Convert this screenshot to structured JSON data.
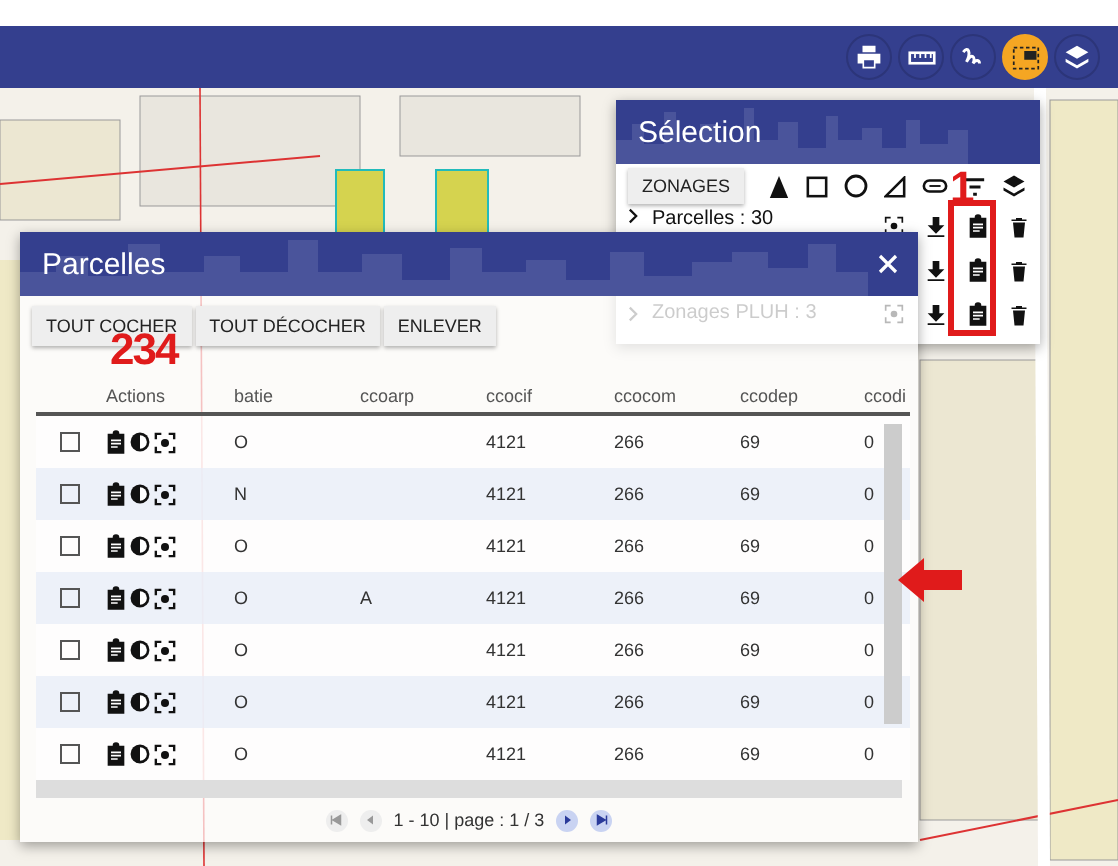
{
  "toolbar": {
    "buttons": [
      {
        "kind": "print",
        "selected": false
      },
      {
        "kind": "ruler",
        "selected": false
      },
      {
        "kind": "draw",
        "selected": false
      },
      {
        "kind": "select",
        "selected": true
      },
      {
        "kind": "layers",
        "selected": false
      }
    ]
  },
  "selection": {
    "title": "Sélection",
    "zonages_button": "ZONAGES",
    "tools": [
      {
        "kind": "pointer"
      },
      {
        "kind": "square"
      },
      {
        "kind": "circle"
      },
      {
        "kind": "triangle"
      },
      {
        "kind": "link"
      },
      {
        "kind": "filter"
      },
      {
        "kind": "layers"
      }
    ],
    "rows": [
      {
        "label": "Parcelles : 30",
        "dimmed": false
      },
      {},
      {
        "label": "Zonages PLUH : 3",
        "dimmed": true
      }
    ]
  },
  "annotations": [
    {
      "text": "1"
    },
    {
      "text": "234"
    }
  ],
  "parcelles": {
    "title": "Parcelles",
    "buttons": [
      "TOUT COCHER",
      "TOUT DÉCOCHER",
      "ENLEVER"
    ],
    "columns": [
      "Actions",
      "batie",
      "ccoarp",
      "ccocif",
      "ccocom",
      "ccodep",
      "ccodi"
    ],
    "rows": [
      {
        "checked": false,
        "cells": [
          null,
          "O",
          null,
          "4121",
          "266",
          "69",
          "0"
        ]
      },
      {
        "checked": false,
        "cells": [
          null,
          "N",
          null,
          "4121",
          "266",
          "69",
          "0"
        ]
      },
      {
        "checked": false,
        "cells": [
          null,
          "O",
          null,
          "4121",
          "266",
          "69",
          "0"
        ]
      },
      {
        "checked": false,
        "cells": [
          null,
          "O",
          "A",
          "4121",
          "266",
          "69",
          "0"
        ]
      },
      {
        "checked": false,
        "cells": [
          null,
          "O",
          null,
          "4121",
          "266",
          "69",
          "0"
        ]
      },
      {
        "checked": false,
        "cells": [
          null,
          "O",
          null,
          "4121",
          "266",
          "69",
          "0"
        ]
      },
      {
        "checked": false,
        "cells": [
          null,
          "O",
          null,
          "4121",
          "266",
          "69",
          "0"
        ]
      }
    ],
    "pagination": "1 - 10 | page : 1 / 3"
  }
}
